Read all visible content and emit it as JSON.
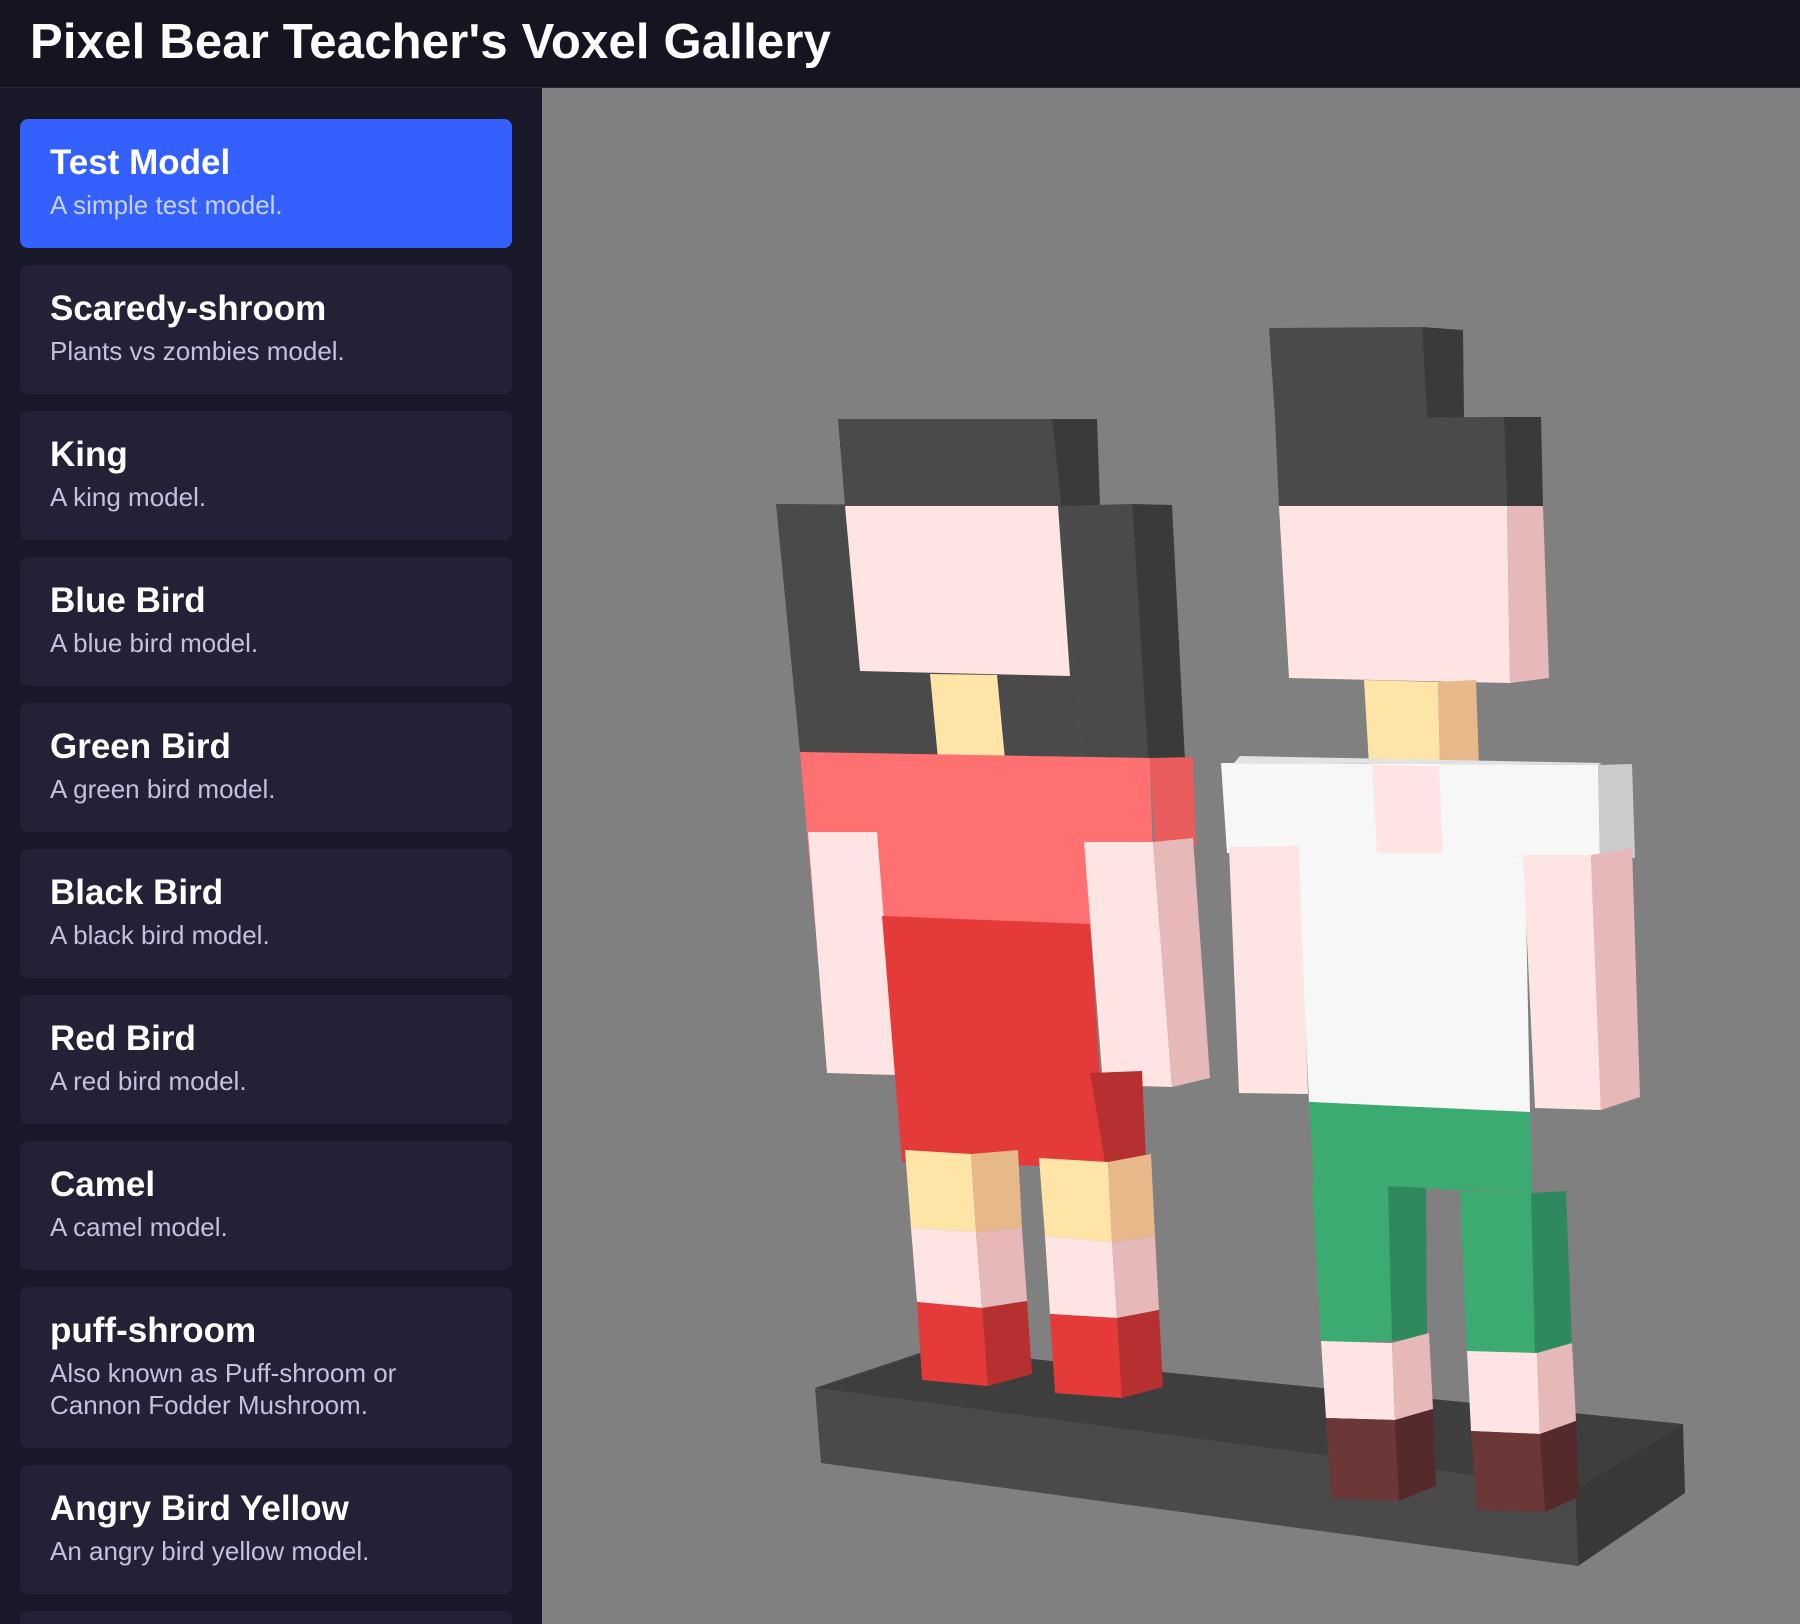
{
  "header": {
    "title": "Pixel Bear Teacher's Voxel Gallery"
  },
  "sidebar": {
    "selected_index": 0,
    "items": [
      {
        "title": "Test Model",
        "description": "A simple test model."
      },
      {
        "title": "Scaredy-shroom",
        "description": "Plants vs zombies model."
      },
      {
        "title": "King",
        "description": "A king model."
      },
      {
        "title": "Blue Bird",
        "description": "A blue bird model."
      },
      {
        "title": "Green Bird",
        "description": "A green bird model."
      },
      {
        "title": "Black Bird",
        "description": "A black bird model."
      },
      {
        "title": "Red Bird",
        "description": "A red bird model."
      },
      {
        "title": "Camel",
        "description": "A camel model."
      },
      {
        "title": "puff-shroom",
        "description": "Also known as Puff-shroom or Cannon Fodder Mushroom."
      },
      {
        "title": "Angry Bird Yellow",
        "description": "An angry bird yellow model."
      }
    ]
  },
  "colors": {
    "header_bg": "#151420",
    "sidebar_bg": "#191829",
    "card_bg": "#222136",
    "card_active_bg": "#3360fe",
    "viewport_bg": "#808080"
  }
}
